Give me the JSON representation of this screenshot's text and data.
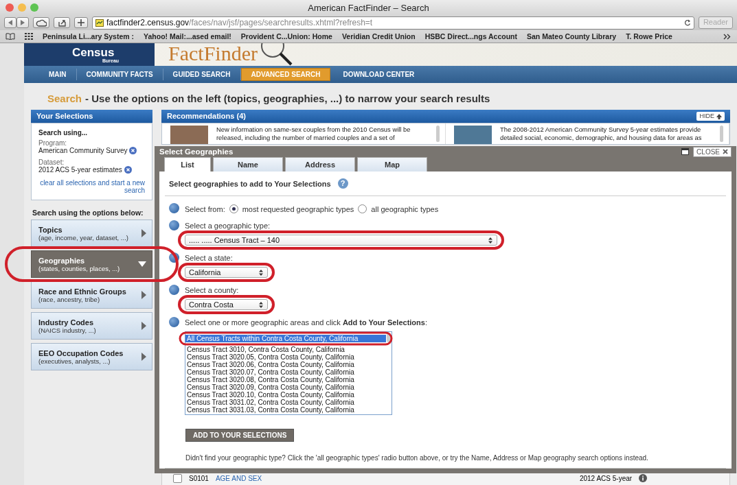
{
  "browser": {
    "title": "American FactFinder – Search",
    "url_host": "factfinder2.census.gov",
    "url_path": "/faces/nav/jsf/pages/searchresults.xhtml?refresh=t",
    "reader": "Reader",
    "bookmarks": [
      "Peninsula Li...ary System :",
      "Yahoo! Mail:...ased email!",
      "Provident C...Union: Home",
      "Veridian Credit Union",
      "HSBC Direct...ngs Account",
      "San Mateo County Library",
      "T. Rowe Price"
    ]
  },
  "site": {
    "logo": "Census",
    "logo_sub": "Bureau",
    "brand": "FactFinder",
    "nav": [
      {
        "label": "MAIN",
        "selected": false
      },
      {
        "label": "COMMUNITY FACTS",
        "selected": false
      },
      {
        "label": "GUIDED SEARCH",
        "selected": false
      },
      {
        "label": "ADVANCED SEARCH",
        "selected": true
      },
      {
        "label": "DOWNLOAD CENTER",
        "selected": false
      }
    ]
  },
  "heading": {
    "label": "Search",
    "text": "- Use the options on the left (topics, geographies, ...) to narrow your search results"
  },
  "selections": {
    "title": "Your Selections",
    "intro": "Search using...",
    "fields": [
      {
        "label": "Program:",
        "value": "American Community Survey"
      },
      {
        "label": "Dataset:",
        "value": "2012 ACS 5-year estimates"
      }
    ],
    "clear_link": "clear all selections and start a new search"
  },
  "options": {
    "title": "Search using the options below:",
    "items": [
      {
        "title": "Topics",
        "subtitle": "(age, income, year, dataset, ...)",
        "expanded": false
      },
      {
        "title": "Geographies",
        "subtitle": "(states, counties, places, ...)",
        "expanded": true
      },
      {
        "title": "Race and Ethnic Groups",
        "subtitle": "(race, ancestry, tribe)",
        "expanded": false
      },
      {
        "title": "Industry Codes",
        "subtitle": "(NAICS industry, ...)",
        "expanded": false
      },
      {
        "title": "EEO Occupation Codes",
        "subtitle": "(executives, analysts, ...)",
        "expanded": false
      }
    ]
  },
  "recommendations": {
    "title": "Recommendations (4)",
    "hide": "HIDE",
    "items": [
      {
        "text": "New information on same-sex couples from the 2010 Census will be released, including the number of married couples and a set of"
      },
      {
        "text": "The 2008-2012 American Community Survey 5-year estimates provide detailed social, economic, demographic, and housing data for areas as"
      }
    ]
  },
  "dialog": {
    "title": "Select Geographies",
    "close": "CLOSE",
    "tabs": [
      {
        "label": "List",
        "selected": true
      },
      {
        "label": "Name",
        "selected": false
      },
      {
        "label": "Address",
        "selected": false
      },
      {
        "label": "Map",
        "selected": false
      }
    ],
    "heading": "Select geographies to add to Your Selections",
    "help": "?",
    "steps": [
      {
        "kind": "radio",
        "label": "Select from:",
        "options": [
          {
            "label": "most requested geographic types",
            "selected": true
          },
          {
            "label": "all geographic types",
            "selected": false
          }
        ]
      },
      {
        "kind": "select",
        "label": "Select a geographic type:",
        "value": "..... ..... Census Tract – 140"
      },
      {
        "kind": "select",
        "label": "Select a state:",
        "value": "California"
      },
      {
        "kind": "select",
        "label": "Select a county:",
        "value": "Contra Costa"
      },
      {
        "kind": "list",
        "label": "Select one or more geographic areas and click **Add to Your Selections**:",
        "options": [
          {
            "label": "All Census Tracts within Contra Costa County, California",
            "selected": true
          },
          {
            "label": "Census Tract 3010, Contra Costa County, California",
            "selected": false
          },
          {
            "label": "Census Tract 3020.05, Contra Costa County, California",
            "selected": false
          },
          {
            "label": "Census Tract 3020.06, Contra Costa County, California",
            "selected": false
          },
          {
            "label": "Census Tract 3020.07, Contra Costa County, California",
            "selected": false
          },
          {
            "label": "Census Tract 3020.08, Contra Costa County, California",
            "selected": false
          },
          {
            "label": "Census Tract 3020.09, Contra Costa County, California",
            "selected": false
          },
          {
            "label": "Census Tract 3020.10, Contra Costa County, California",
            "selected": false
          },
          {
            "label": "Census Tract 3031.02, Contra Costa County, California",
            "selected": false
          },
          {
            "label": "Census Tract 3031.03, Contra Costa County, California",
            "selected": false
          }
        ]
      }
    ],
    "button": "ADD TO YOUR SELECTIONS",
    "footnote": "Didn't find your geographic type? Click the 'all geographic types' radio button above, or try the Name, Address or Map geography search options instead."
  },
  "results": {
    "rows": [
      {
        "code": "S0101",
        "title": "AGE AND SEX",
        "dataset": "2012 ACS 5-year",
        "checked": false
      }
    ]
  }
}
